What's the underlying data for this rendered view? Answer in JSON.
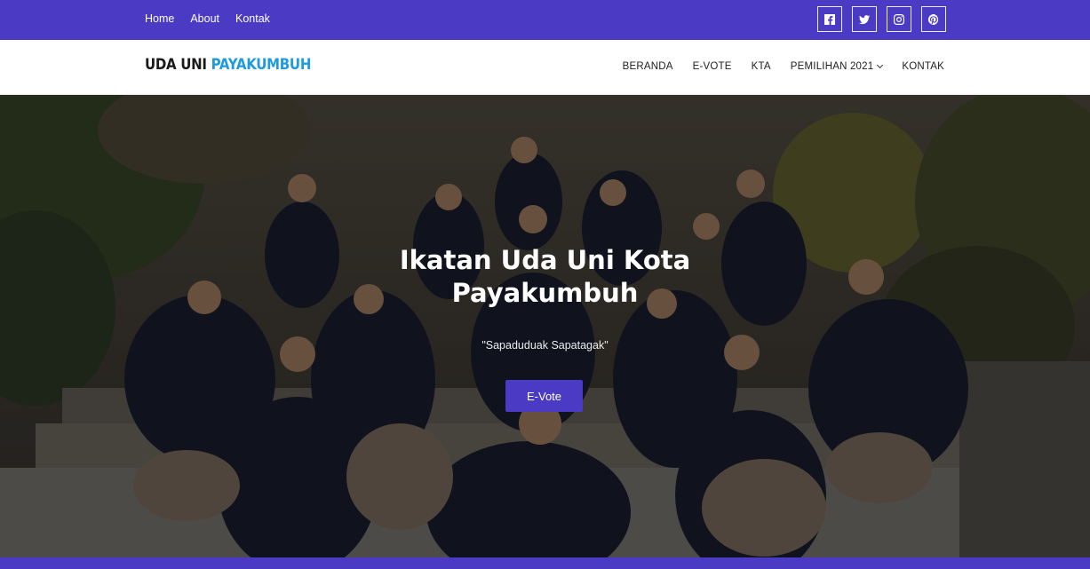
{
  "topbar": {
    "links": [
      "Home",
      "About",
      "Kontak"
    ],
    "socials": [
      "facebook-icon",
      "twitter-icon",
      "instagram-icon",
      "pinterest-icon"
    ],
    "color": "#4b3ac4"
  },
  "nav": {
    "logo_part1": "UDA UNI ",
    "logo_part2": "PAYAKUMBUH",
    "items": [
      "BERANDA",
      "E-VOTE",
      "KTA",
      "PEMILIHAN 2021",
      "KONTAK"
    ]
  },
  "hero": {
    "title_line1": "Ikatan Uda Uni Kota",
    "title_line2": "Payakumbuh",
    "subtitle": "\"Sapaduduak Sapatagak\"",
    "button": "E-Vote",
    "image": "group-photo"
  }
}
